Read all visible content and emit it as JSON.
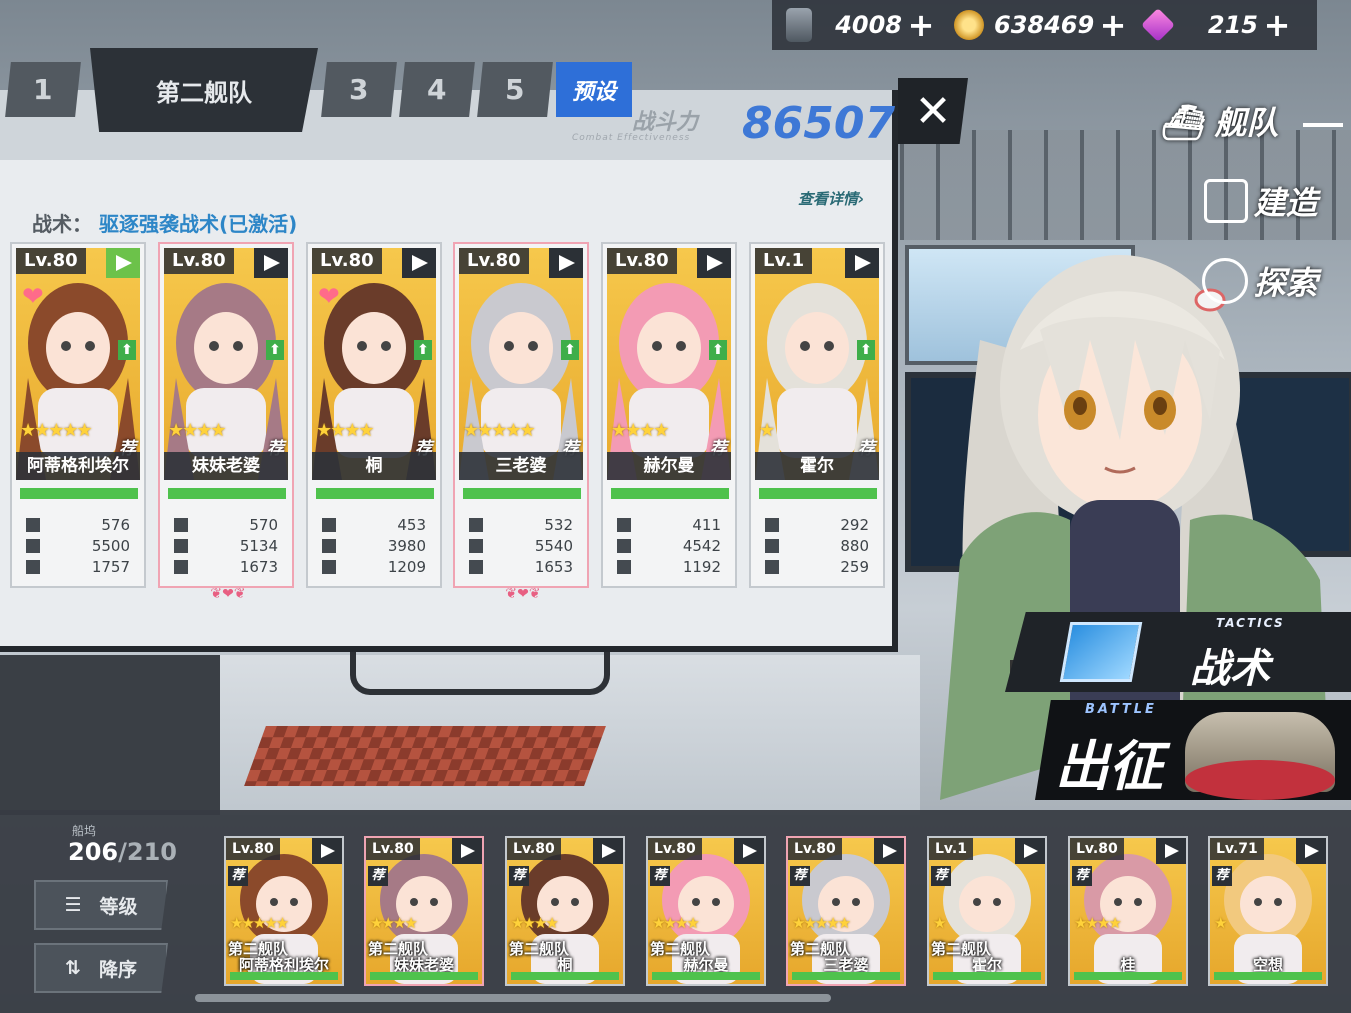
{
  "resources": [
    {
      "icon": "oil-icon",
      "value": "4008"
    },
    {
      "icon": "gold-coin-icon",
      "value": "638469"
    },
    {
      "icon": "gem-icon",
      "value": "215"
    }
  ],
  "resource_plus": "+",
  "fleet_tabs": [
    "1",
    "第二舰队",
    "3",
    "4",
    "5"
  ],
  "preset_tab": "预设",
  "combat": {
    "label": "战斗力",
    "sublabel": "Combat Effectiveness",
    "value": "86507"
  },
  "close_symbol": "✕",
  "detail_link": "查看详情",
  "tactic": {
    "label": "战术：",
    "value": "驱逐强袭战术(已激活)"
  },
  "fleet_cards": [
    {
      "level": "Lv.80",
      "name": "阿蒂格利埃尔",
      "stars": "★★★★★",
      "rec": "荐",
      "stats": [
        "576",
        "5500",
        "1757"
      ],
      "flag": "green",
      "heart": true,
      "fav": false,
      "hair": "#8b4a2b"
    },
    {
      "level": "Lv.80",
      "name": "妹妹老婆",
      "stars": "★★★★",
      "rec": "荐",
      "stats": [
        "570",
        "5134",
        "1673"
      ],
      "flag": "dark",
      "heart": false,
      "fav": true,
      "hair": "#a67a86"
    },
    {
      "level": "Lv.80",
      "name": "桐",
      "stars": "★★★★",
      "rec": "荐",
      "stats": [
        "453",
        "3980",
        "1209"
      ],
      "flag": "dark",
      "heart": true,
      "fav": false,
      "hair": "#6a3c2a"
    },
    {
      "level": "Lv.80",
      "name": "三老婆",
      "stars": "★★★★★",
      "rec": "荐",
      "stats": [
        "532",
        "5540",
        "1653"
      ],
      "flag": "dark",
      "heart": false,
      "fav": true,
      "hair": "#c9c9cf"
    },
    {
      "level": "Lv.80",
      "name": "赫尔曼",
      "stars": "★★★★",
      "rec": "荐",
      "stats": [
        "411",
        "4542",
        "1192"
      ],
      "flag": "dark",
      "heart": false,
      "fav": false,
      "hair": "#f39bb4"
    },
    {
      "level": "Lv.1",
      "name": "霍尔",
      "stars": "★",
      "rec": "荐",
      "stats": [
        "292",
        "880",
        "259"
      ],
      "flag": "dark",
      "heart": false,
      "fav": false,
      "hair": "#e4e1da"
    }
  ],
  "side_menu": {
    "fleet": "舰队",
    "build": "建造",
    "explore": "探索"
  },
  "tactics_button": {
    "sub": "TACTICS",
    "label": "战术"
  },
  "battle_button": {
    "sub": "BATTLE",
    "label": "出征"
  },
  "dock": {
    "label": "船坞",
    "count": "206",
    "max": "/210",
    "sort_level": "等级",
    "sort_order": "降序"
  },
  "dock_cards": [
    {
      "level": "Lv.80",
      "fleet": "第二舰队",
      "name": "阿蒂格利埃尔",
      "stars": "★★★★★",
      "fav": false,
      "hair": "#8b4a2b"
    },
    {
      "level": "Lv.80",
      "fleet": "第二舰队",
      "name": "妹妹老婆",
      "stars": "★★★★",
      "fav": true,
      "hair": "#a67a86"
    },
    {
      "level": "Lv.80",
      "fleet": "第二舰队",
      "name": "桐",
      "stars": "★★★★",
      "fav": false,
      "hair": "#6a3c2a"
    },
    {
      "level": "Lv.80",
      "fleet": "第二舰队",
      "name": "赫尔曼",
      "stars": "★★★★",
      "fav": false,
      "hair": "#f39bb4"
    },
    {
      "level": "Lv.80",
      "fleet": "第二舰队",
      "name": "三老婆",
      "stars": "★★★★★",
      "fav": true,
      "hair": "#c9c9cf"
    },
    {
      "level": "Lv.1",
      "fleet": "第二舰队",
      "name": "霍尔",
      "stars": "★",
      "fav": false,
      "hair": "#e4e1da"
    },
    {
      "level": "Lv.80",
      "fleet": "",
      "name": "桂",
      "stars": "★★★★",
      "fav": false,
      "hair": "#d99aa6"
    },
    {
      "level": "Lv.71",
      "fleet": "",
      "name": "空想",
      "stars": "★",
      "fav": false,
      "hair": "#f2c97e"
    }
  ],
  "rec_label": "荐"
}
